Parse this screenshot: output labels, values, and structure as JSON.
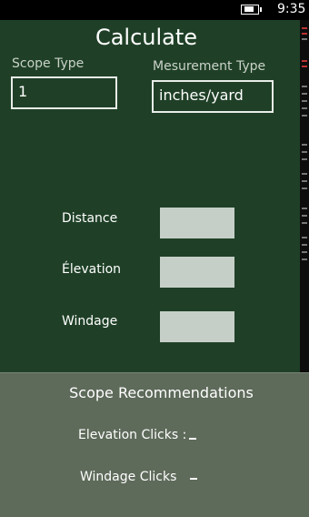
{
  "status": {
    "time": "9:35",
    "battery_icon": "battery-charging-icon"
  },
  "page": {
    "title": "Calculate"
  },
  "scope_type": {
    "label": "Scope Type",
    "value": "1"
  },
  "measurement_type": {
    "label": "Mesurement Type",
    "value": "inches/yard"
  },
  "inputs": {
    "distance_label": "Distance",
    "elevation_label": "Élevation",
    "windage_label": "Windage"
  },
  "recommendations": {
    "title": "Scope  Recommendations",
    "elevation_label": "Elevation Clicks :",
    "elevation_value": "-",
    "windage_label": "Windage Clicks",
    "windage_value": "-"
  },
  "colors": {
    "background": "#1f4027",
    "panel": "#5e6a5a",
    "input_fill": "#c6cfc7"
  }
}
